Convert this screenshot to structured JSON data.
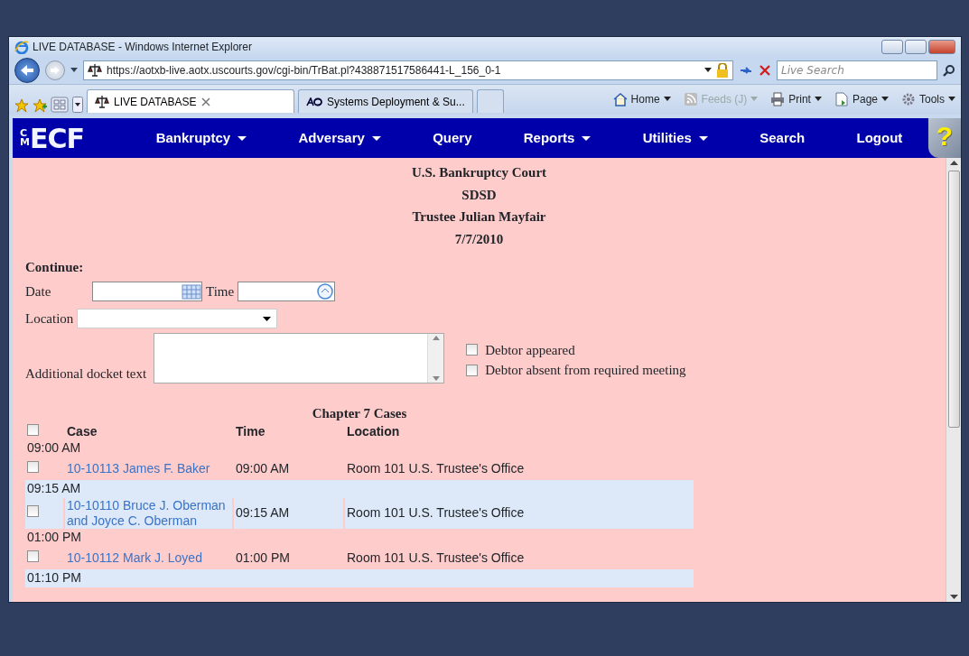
{
  "window": {
    "title": "LIVE DATABASE - Windows Internet Explorer"
  },
  "address_bar": {
    "url": "https://aotxb-live.aotx.uscourts.gov/cgi-bin/TrBat.pl?438871517586441-L_156_0-1"
  },
  "search": {
    "placeholder": "Live Search"
  },
  "tabs": [
    {
      "label": "LIVE DATABASE",
      "selected": true,
      "kind": "scales"
    },
    {
      "label": "Systems Deployment & Su...",
      "selected": false,
      "kind": "ao"
    }
  ],
  "command_bar": [
    {
      "label": "Home",
      "kind": "home",
      "disabled": false
    },
    {
      "label": "Feeds (J)",
      "kind": "feeds",
      "disabled": true
    },
    {
      "label": "Print",
      "kind": "print",
      "disabled": false
    },
    {
      "label": "Page",
      "kind": "page",
      "disabled": false
    },
    {
      "label": "Tools",
      "kind": "tools",
      "disabled": false
    }
  ],
  "logo": {
    "prefix": "CM",
    "text": "ECF"
  },
  "menu": [
    {
      "label": "Bankruptcy",
      "dropdown": true
    },
    {
      "label": "Adversary",
      "dropdown": true
    },
    {
      "label": "Query",
      "dropdown": false
    },
    {
      "label": "Reports",
      "dropdown": true
    },
    {
      "label": "Utilities",
      "dropdown": true
    },
    {
      "label": "Search",
      "dropdown": false
    },
    {
      "label": "Logout",
      "dropdown": false
    }
  ],
  "help": {
    "label": "?"
  },
  "heading": [
    "U.S. Bankruptcy Court",
    "SDSD",
    "Trustee Julian Mayfair",
    "7/7/2010"
  ],
  "form": {
    "title": "Continue:",
    "date_label": "Date",
    "time_label": "Time",
    "location_label": "Location",
    "docket_label": "Additional docket text",
    "checkboxes": [
      {
        "label": "Debtor appeared",
        "checked": false
      },
      {
        "label": "Debtor absent from required meeting",
        "checked": false
      }
    ]
  },
  "cases": {
    "title": "Chapter 7 Cases",
    "select_all": {
      "checked": false
    },
    "columns": [
      "Case",
      "Time",
      "Location"
    ],
    "groups": [
      {
        "time": "09:00 AM",
        "highlighted": false,
        "rows": [
          {
            "case": "10-10113 James F. Baker",
            "time": "09:00 AM",
            "location": "Room 101 U.S. Trustee's Office",
            "checked": false
          }
        ]
      },
      {
        "time": "09:15 AM",
        "highlighted": true,
        "rows": [
          {
            "case": "10-10110 Bruce J. Oberman and Joyce C. Oberman",
            "time": "09:15 AM",
            "location": "Room 101 U.S. Trustee's Office",
            "checked": false
          }
        ]
      },
      {
        "time": "01:00 PM",
        "highlighted": false,
        "rows": [
          {
            "case": "10-10112 Mark J. Loyed",
            "time": "01:00 PM",
            "location": "Room 101 U.S. Trustee's Office",
            "checked": false
          }
        ]
      },
      {
        "time": "01:10 PM",
        "highlighted": true
      }
    ]
  }
}
